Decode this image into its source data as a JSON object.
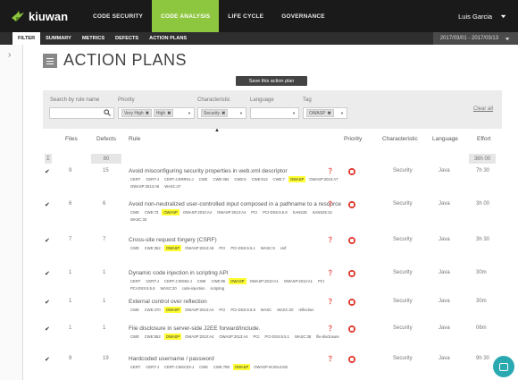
{
  "app": {
    "name": "kiuwan"
  },
  "topnav": [
    {
      "label": "CODE SECURITY",
      "active": false
    },
    {
      "label": "CODE ANALYSIS",
      "active": true
    },
    {
      "label": "LIFE CYCLE",
      "active": false
    },
    {
      "label": "GOVERNANCE",
      "active": false
    }
  ],
  "user": {
    "name": "Luis Garcia"
  },
  "subnav": {
    "filter_label": "FILTER",
    "tabs": [
      "SUMMARY",
      "METRICS",
      "DEFECTS",
      "ACTION PLANS"
    ],
    "date_range": "2017/03/01 - 2017/03/13"
  },
  "page": {
    "title": "ACTION PLANS",
    "save_label": "Save this action plan"
  },
  "filters": {
    "search_label": "Search by rule name",
    "search_value": "",
    "priority_label": "Priority",
    "priority_chips": [
      "Very High",
      "High"
    ],
    "characteristic_label": "Characteristic",
    "characteristic_chips": [
      "Security"
    ],
    "language_label": "Language",
    "language_value": "",
    "tag_label": "Tag",
    "tag_chips": [
      "OWASP"
    ],
    "clear_label": "Clear all"
  },
  "table": {
    "headers": {
      "files": "Files",
      "defects": "Defects",
      "rule": "Rule",
      "priority": "Priority",
      "characteristic": "Characteristic",
      "language": "Language",
      "effort": "Effort"
    },
    "summary": {
      "symbol": "Σ",
      "defects": "80",
      "effort": "38h 00"
    },
    "rows": [
      {
        "files": "9",
        "defects": "15",
        "rule": "Avoid misconfiguring security properties in web.xml descriptor",
        "tags": [
          "CERT",
          "CERT-J",
          "CERT-J:ERR01-J",
          "CWE",
          "CWE:384",
          "CWE:5",
          "CWE:613",
          "CWE:7",
          "OWASP",
          "OWASP:2010:A7",
          "OWASP:2013:A6",
          "WASC:47"
        ],
        "characteristic": "Security",
        "language": "Java",
        "effort": "7h 30"
      },
      {
        "files": "6",
        "defects": "6",
        "rule": "Avoid non-neutralized user-controlled input composed in a pathname to a resource",
        "tags": [
          "CWE",
          "CWE:73",
          "OWASP",
          "OWASP:2010:A4",
          "OWASP:2013:A4",
          "PCI",
          "PCI-DSS:6.5.8",
          "SANS25",
          "SANS25:13",
          "WASC:33"
        ],
        "characteristic": "Security",
        "language": "Java",
        "effort": "3h 00"
      },
      {
        "files": "7",
        "defects": "7",
        "rule": "Cross-site request forgery (CSRF)",
        "tags": [
          "CWE",
          "CWE:352",
          "OWASP",
          "OWASP:2013:A8",
          "PCI",
          "PCI-DSS:6.5.1",
          "WASC:9",
          "csrf"
        ],
        "characteristic": "Security",
        "language": "Java",
        "effort": "3h 30"
      },
      {
        "files": "1",
        "defects": "1",
        "rule": "Dynamic code injection in scripting API",
        "tags": [
          "CERT",
          "CERT-J",
          "CERT-J:IDS52-J",
          "CWE",
          "CWE:95",
          "OWASP",
          "OWASP:2010:A1",
          "OWASP:2013:A1",
          "PCI",
          "PCI-DSS:6.5.6",
          "WASC:20",
          "code-injection",
          "scripting"
        ],
        "characteristic": "Security",
        "language": "Java",
        "effort": "30m"
      },
      {
        "files": "1",
        "defects": "1",
        "rule": "External control over reflection",
        "tags": [
          "CWE",
          "CWE:470",
          "OWASP",
          "OWASP:2013:A4",
          "PCI",
          "PCI-DSS:6.5.8",
          "WASC",
          "WASC:20",
          "reflection"
        ],
        "characteristic": "Security",
        "language": "Java",
        "effort": "30m"
      },
      {
        "files": "1",
        "defects": "1",
        "rule": "File disclosure in server-side J2EE forward/include.",
        "tags": [
          "CWE",
          "CWE:552",
          "OWASP",
          "OWASP:2010:A4",
          "OWASP:2013:A4",
          "PCI",
          "PCI-DSS:6.5.1",
          "WASC:38",
          "file-disclosure"
        ],
        "characteristic": "Security",
        "language": "Java",
        "effort": "06m"
      },
      {
        "files": "9",
        "defects": "19",
        "rule": "Hardcoded username / password",
        "tags": [
          "CERT",
          "CERT-J",
          "CERT-J:MSC03-J",
          "CWE",
          "CWE:798",
          "OWASP",
          "OWASP-M:2014:M2"
        ],
        "characteristic": "Security",
        "language": "Java",
        "effort": "9h 30"
      }
    ]
  },
  "colors": {
    "accent": "#8dc63f",
    "priority": "#e03a2f",
    "highlight": "#ffff33",
    "chat": "#2aa9b0"
  }
}
